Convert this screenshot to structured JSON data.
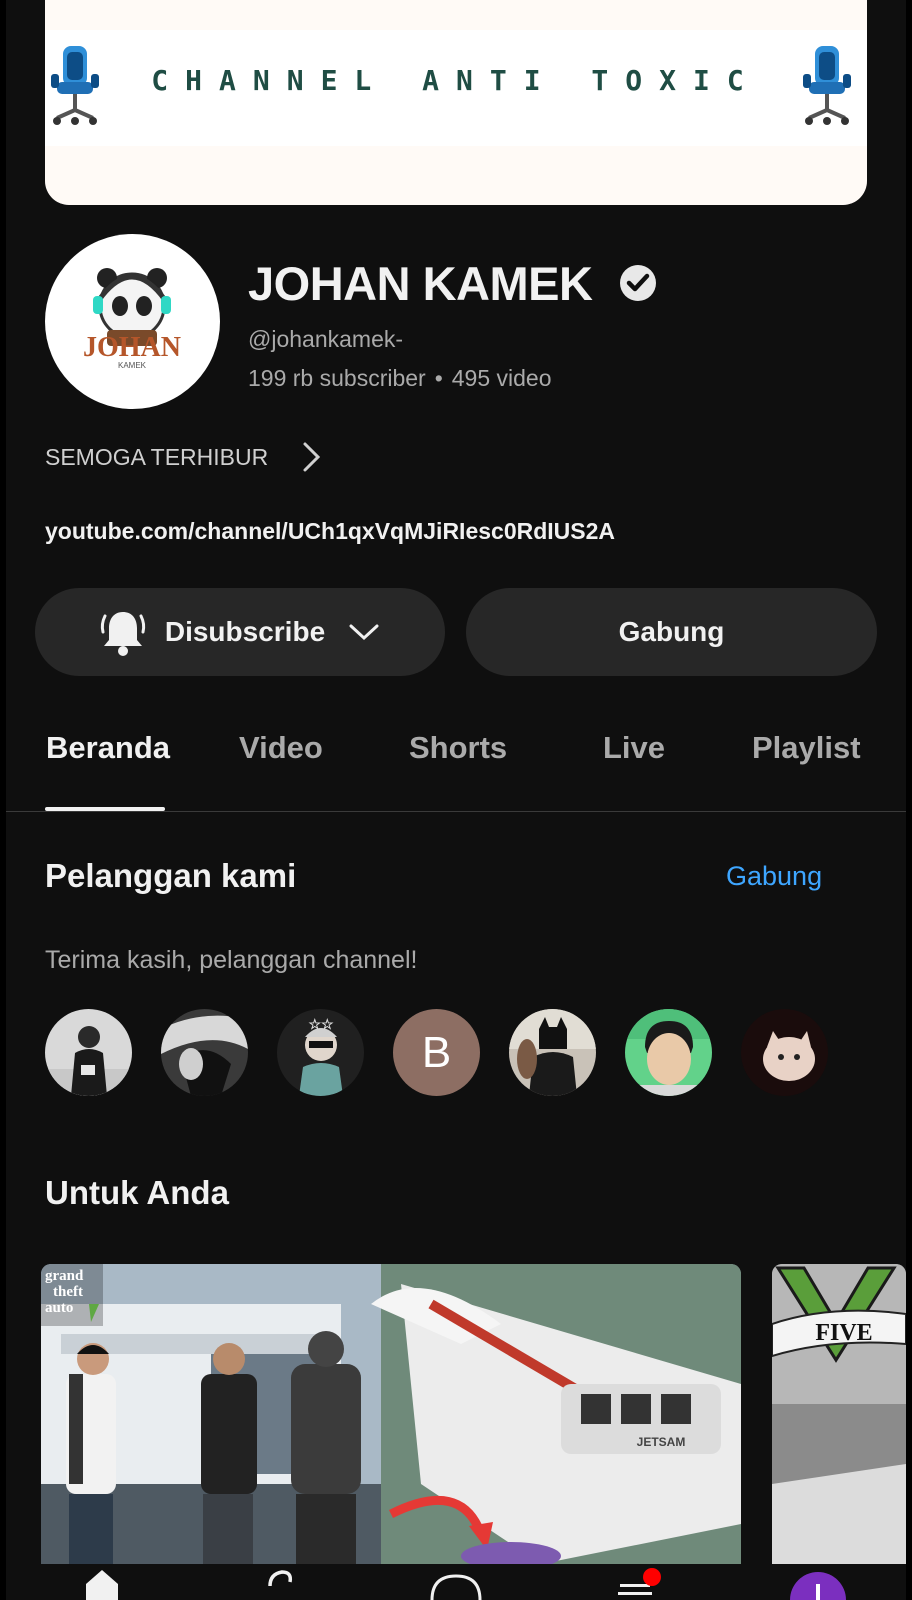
{
  "banner": {
    "text": "CHANNEL ANTI TOXIC"
  },
  "channel": {
    "avatar_text": "JOHAN",
    "avatar_subtext": "KAMEK",
    "name": "JOHAN KAMEK",
    "handle": "@johankamek-",
    "subscribers": "199 rb subscriber",
    "videos": "495 video",
    "separator": "•",
    "description": "SEMOGA TERHIBUR",
    "link": "youtube.com/channel/UCh1qxVqMJiRIesc0RdIUS2A"
  },
  "actions": {
    "subscribe_label": "Disubscribe",
    "join_label": "Gabung"
  },
  "tabs": [
    {
      "label": "Beranda",
      "active": true
    },
    {
      "label": "Video",
      "active": false
    },
    {
      "label": "Shorts",
      "active": false
    },
    {
      "label": "Live",
      "active": false
    },
    {
      "label": "Playlist",
      "active": false
    }
  ],
  "members_section": {
    "title": "Pelanggan kami",
    "join_link": "Gabung",
    "thanks": "Terima kasih, pelanggan channel!",
    "letter_member": "B"
  },
  "for_you": {
    "title": "Untuk Anda",
    "thumb1_logo": [
      "grand",
      "theft",
      "auto"
    ],
    "thumb1_heli_text": "JETSAM",
    "thumb2_text": "FIVE"
  },
  "colors": {
    "background": "#0f0f0f",
    "button": "#272727",
    "accent_link": "#3ea6ff",
    "banner_text": "#1f4d44",
    "notification_dot": "#ff0000",
    "create_button": "#7b2fbf"
  }
}
